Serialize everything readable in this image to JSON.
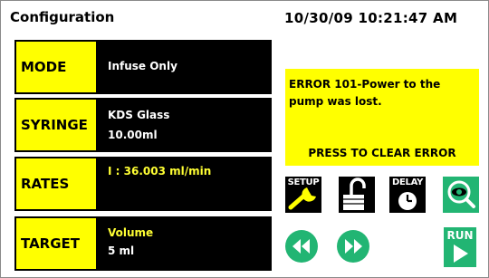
{
  "header": {
    "title": "Configuration",
    "datetime": "10/30/09 10:21:47 AM"
  },
  "params": {
    "mode": {
      "label": "MODE",
      "value": "Infuse Only"
    },
    "syringe": {
      "label": "SYRINGE",
      "line1": "KDS Glass",
      "line2": "10.00ml"
    },
    "rates": {
      "label": "RATES",
      "value": "I : 36.003 ml/min"
    },
    "target": {
      "label": "TARGET",
      "line1": "Volume",
      "line2": "5 ml"
    }
  },
  "error": {
    "message": "ERROR 101-Power to the pump was lost.",
    "action": "PRESS TO CLEAR ERROR"
  },
  "buttons": {
    "setup": "SETUP",
    "delay": "DELAY",
    "run": "RUN"
  },
  "icons": {
    "setup": "wrench-icon",
    "lock": "unlock-icon",
    "delay": "clock-icon",
    "view": "eye-icon",
    "rewind": "rewind-icon",
    "fast_forward": "fast-forward-icon",
    "run": "play-icon"
  },
  "colors": {
    "accent_yellow": "#ffff00",
    "value_yellow": "#ffff33",
    "panel_black": "#000000",
    "action_green": "#22b573"
  }
}
